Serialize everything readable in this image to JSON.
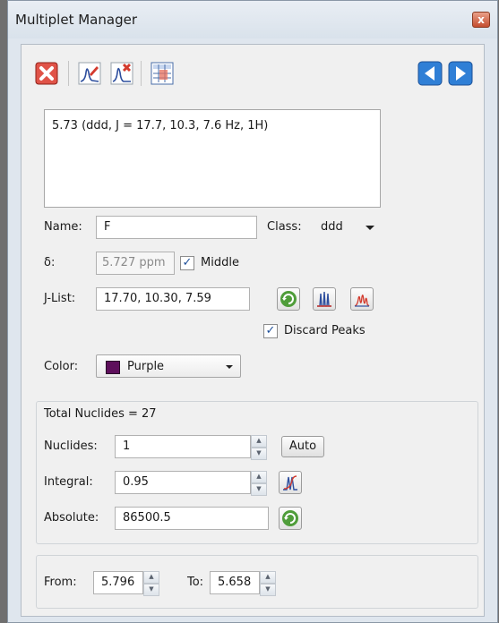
{
  "window": {
    "title": "Multiplet Manager",
    "close_glyph": "x"
  },
  "toolbar": {
    "icons": [
      "delete-multiplet-icon",
      "edit-multiplet-icon",
      "remove-peak-icon",
      "multiplet-table-icon",
      "previous-arrow-icon",
      "next-arrow-icon"
    ]
  },
  "description": {
    "text": "5.73 (ddd, J = 17.7, 10.3, 7.6 Hz, 1H)"
  },
  "form": {
    "name_label": "Name:",
    "name_value": "F",
    "class_label": "Class:",
    "class_value": "ddd",
    "delta_label": "δ:",
    "delta_value": "5.727 ppm",
    "middle_label": "Middle",
    "middle_checked": true,
    "jlist_label": "J-List:",
    "jlist_value": "17.70, 10.30, 7.59",
    "discard_label": "Discard Peaks",
    "discard_checked": true,
    "color_label": "Color:",
    "color_value": "Purple",
    "color_swatch": "#5e0f5c"
  },
  "nuclides": {
    "total_label": "Total Nuclides = 27",
    "nuclides_label": "Nuclides:",
    "nuclides_value": "1",
    "auto_label": "Auto",
    "integral_label": "Integral:",
    "integral_value": "0.95",
    "absolute_label": "Absolute:",
    "absolute_value": "86500.5"
  },
  "range": {
    "from_label": "From:",
    "from_value": "5.796",
    "to_label": "To:",
    "to_value": "5.658"
  },
  "colors": {
    "accent_blue": "#2f7fd6",
    "red_x": "#c8332b",
    "refresh_green": "#4f9d3a"
  }
}
